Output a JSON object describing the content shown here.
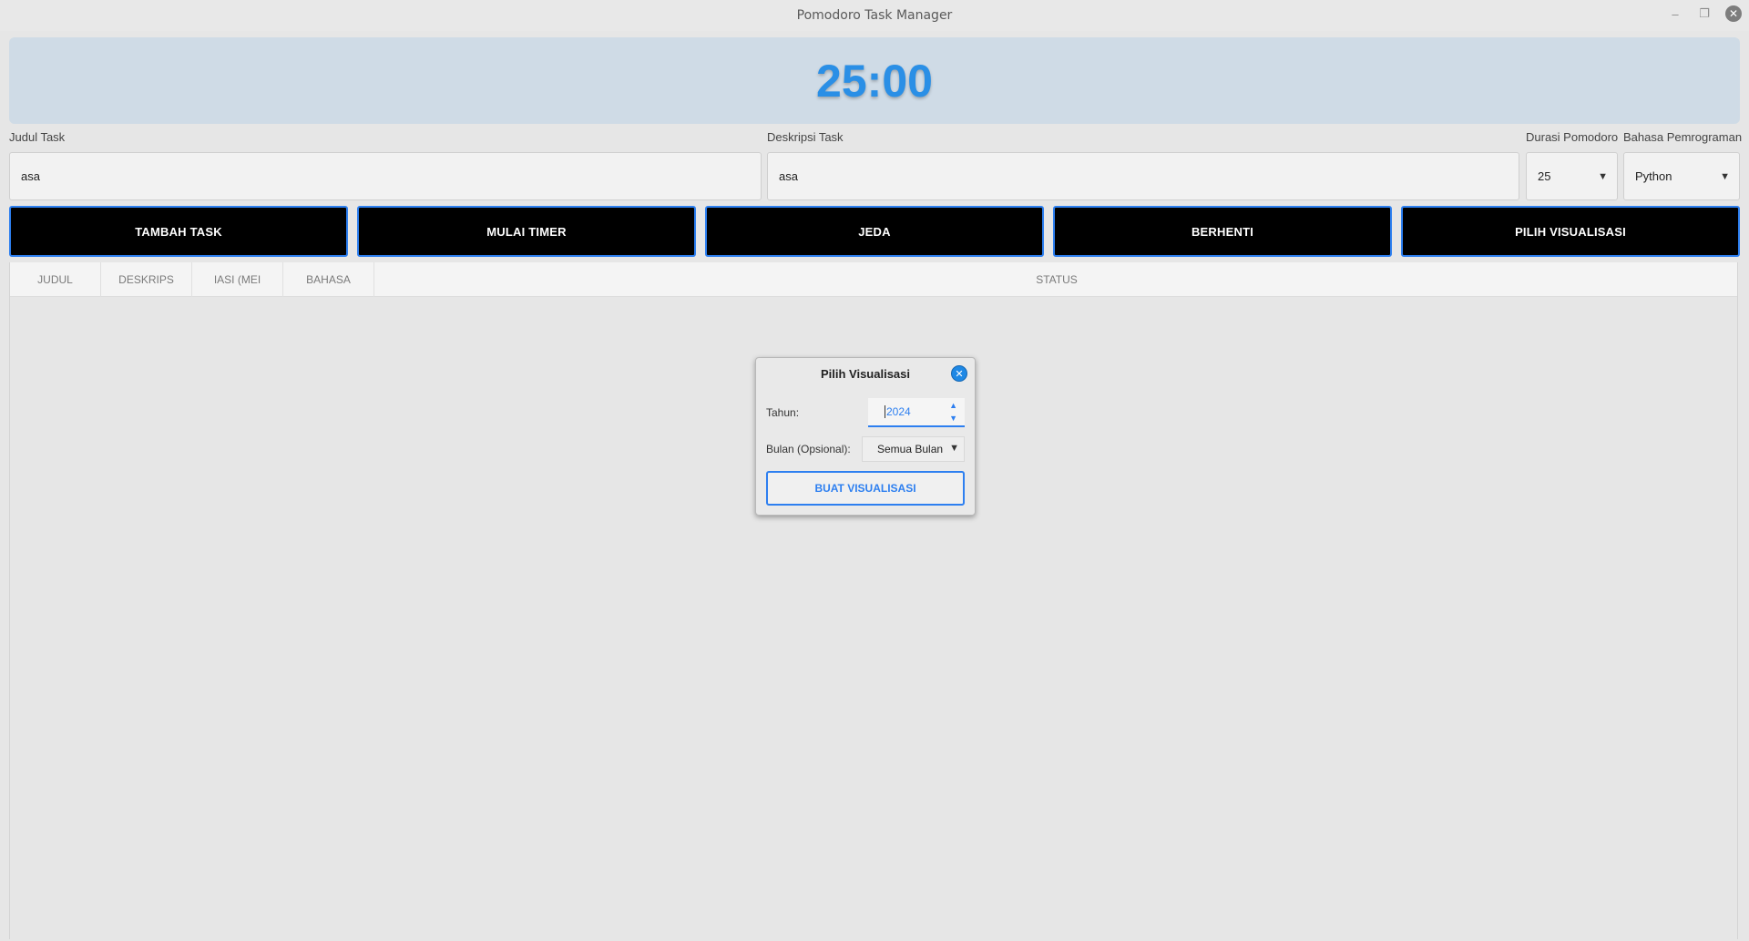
{
  "window": {
    "title": "Pomodoro Task Manager",
    "minimize_icon": "minimize-icon",
    "maximize_icon": "maximize-icon",
    "close_icon": "close-icon"
  },
  "timer": {
    "display": "25:00",
    "color": "#2a8fe6"
  },
  "form": {
    "title_label": "Judul Task",
    "title_value": "asa",
    "description_label": "Deskripsi Task",
    "description_value": "asa",
    "duration_label": "Durasi Pomodoro",
    "duration_value": "25",
    "language_label": "Bahasa Pemrograman",
    "language_value": "Python"
  },
  "buttons": {
    "add_task": "TAMBAH TASK",
    "start_timer": "MULAI TIMER",
    "pause": "JEDA",
    "stop": "BERHENTI",
    "choose_visualization": "PILIH VISUALISASI",
    "accent": "#2d7ff0"
  },
  "table": {
    "columns": [
      "JUDUL",
      "DESKRIPS",
      "IASI (MEI",
      "BAHASA",
      "STATUS"
    ],
    "rows": []
  },
  "dialog": {
    "title": "Pilih Visualisasi",
    "year_label": "Tahun:",
    "year_value": "2024",
    "month_label": "Bulan (Opsional):",
    "month_value": "Semua Bulan",
    "submit": "BUAT VISUALISASI"
  }
}
